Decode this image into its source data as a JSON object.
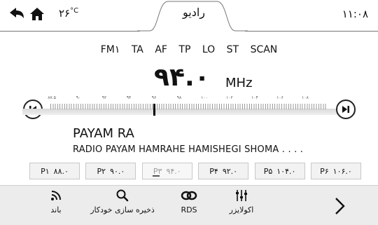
{
  "header": {
    "title": "رادیو",
    "temperature": "۲۶",
    "temperature_unit": "°C",
    "time": "۱۱:۰۸",
    "back_icon": "back-arrow-icon",
    "home_icon": "home-icon"
  },
  "modes": [
    "FM۱",
    "TA",
    "AF",
    "TP",
    "LO",
    "ST",
    "SCAN"
  ],
  "frequency": {
    "value": "۹۴.۰",
    "unit": "MHz"
  },
  "tuner": {
    "scale_labels": [
      "۸۷.۵",
      "۹۰",
      "۹۲",
      "۹۴",
      "۹۶",
      "۹۸",
      "۱۰۰",
      "۱۰۲",
      "۱۰۴",
      "۱۰۶",
      "۱۰۸"
    ],
    "seek_back_icon": "skip-back-icon",
    "seek_forward_icon": "skip-forward-icon"
  },
  "station": {
    "name": "PAYAM RA",
    "radiotext": "RADIO PAYAM HAMRAHE HAMISHEGI SHOMA . . . ."
  },
  "presets": [
    {
      "label": "P۱",
      "freq": "۸۸.۰",
      "active": false
    },
    {
      "label": "P۲",
      "freq": "۹۰.۰",
      "active": false
    },
    {
      "label": "P۳",
      "freq": "۹۴.۰",
      "active": true
    },
    {
      "label": "P۴",
      "freq": "۹۲.۰",
      "active": false
    },
    {
      "label": "P۵",
      "freq": "۱۰۴.۰",
      "active": false
    },
    {
      "label": "P۶",
      "freq": "۱۰۶.۰",
      "active": false
    }
  ],
  "bottom": {
    "band_label": "باند",
    "autosave_label": "ذخیره سازی خودکار",
    "rds_label": "RDS",
    "eq_label": "اکولایزر",
    "next_icon": "chevron-right-icon"
  }
}
